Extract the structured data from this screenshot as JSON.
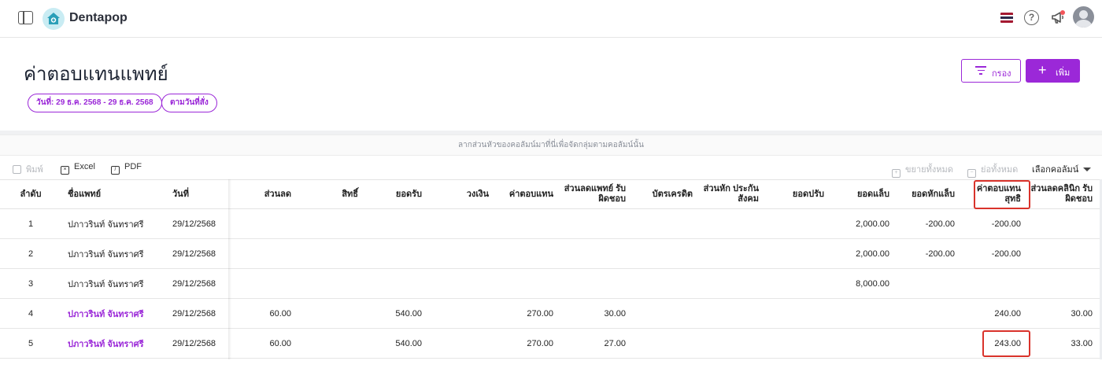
{
  "header": {
    "brand": "Dentapop",
    "flag_colors": [
      "#a51931",
      "#f4f5f8",
      "#2d2a4a",
      "#f4f5f8",
      "#a51931"
    ],
    "help_symbol": "?"
  },
  "page": {
    "title": "ค่าตอบแทนแพทย์",
    "chips": {
      "date_range": "วันที่: 29 ธ.ค. 2568 - 29 ธ.ค. 2568",
      "order": "ตามวันที่สั่ง"
    },
    "filter_label": "กรอง",
    "add_label": "เพิ่ม",
    "accent_color": "#9b28d8"
  },
  "grid": {
    "group_hint": "ลากส่วนหัวของคอลัมน์มาที่นี่เพื่อจัดกลุ่มตามคอลัมน์นั้น",
    "toolbar": {
      "print": "พิมพ์",
      "excel": "Excel",
      "pdf": "PDF",
      "expand_all": "ขยายทั้งหมด",
      "collapse_all": "ย่อทั้งหมด",
      "column_chooser": "เลือกคอลัมน์"
    },
    "columns": [
      "ลำดับ",
      "ชื่อแพทย์",
      "วันที่",
      "ส่วนลด",
      "สิทธิ์",
      "ยอดรับ",
      "วงเงิน",
      "ค่าตอบแทน",
      "ส่วนลดแพทย์ รับผิดชอบ",
      "บัตรเครดิต",
      "ส่วนหัก ประกันสังคม",
      "ยอดปรับ",
      "ยอดแล็บ",
      "ยอดหักแล็บ",
      "ค่าตอบแทน สุทธิ",
      "ส่วนลดคลินิก รับผิดชอบ"
    ],
    "rows": [
      {
        "seq": "1",
        "name": "ปภาวรินท์ จันทราศรี",
        "date": "29/12/2568",
        "c1": "",
        "c2": "",
        "c3": "",
        "c4": "",
        "c5": "",
        "c6": "",
        "c7": "",
        "c8": "",
        "c9": "",
        "c10": "2,000.00",
        "c11": "-200.00",
        "c12": "-200.00",
        "c13": ""
      },
      {
        "seq": "2",
        "name": "ปภาวรินท์ จันทราศรี",
        "date": "29/12/2568",
        "c1": "",
        "c2": "",
        "c3": "",
        "c4": "",
        "c5": "",
        "c6": "",
        "c7": "",
        "c8": "",
        "c9": "",
        "c10": "2,000.00",
        "c11": "-200.00",
        "c12": "-200.00",
        "c13": ""
      },
      {
        "seq": "3",
        "name": "ปภาวรินท์ จันทราศรี",
        "date": "29/12/2568",
        "c1": "",
        "c2": "",
        "c3": "",
        "c4": "",
        "c5": "",
        "c6": "",
        "c7": "",
        "c8": "",
        "c9": "",
        "c10": "8,000.00",
        "c11": "",
        "c12": "",
        "c13": ""
      },
      {
        "seq": "4",
        "name": "ปภาวรินท์ จันทราศรี",
        "date": "29/12/2568",
        "c1": "60.00",
        "c2": "",
        "c3": "540.00",
        "c4": "",
        "c5": "270.00",
        "c6": "30.00",
        "c7": "",
        "c8": "",
        "c9": "",
        "c10": "",
        "c11": "",
        "c12": "240.00",
        "c13": "30.00"
      },
      {
        "seq": "5",
        "name": "ปภาวรินท์ จันทราศรี",
        "date": "29/12/2568",
        "c1": "60.00",
        "c2": "",
        "c3": "540.00",
        "c4": "",
        "c5": "270.00",
        "c6": "27.00",
        "c7": "",
        "c8": "",
        "c9": "",
        "c10": "",
        "c11": "",
        "c12": "243.00",
        "c13": "33.00"
      }
    ]
  }
}
